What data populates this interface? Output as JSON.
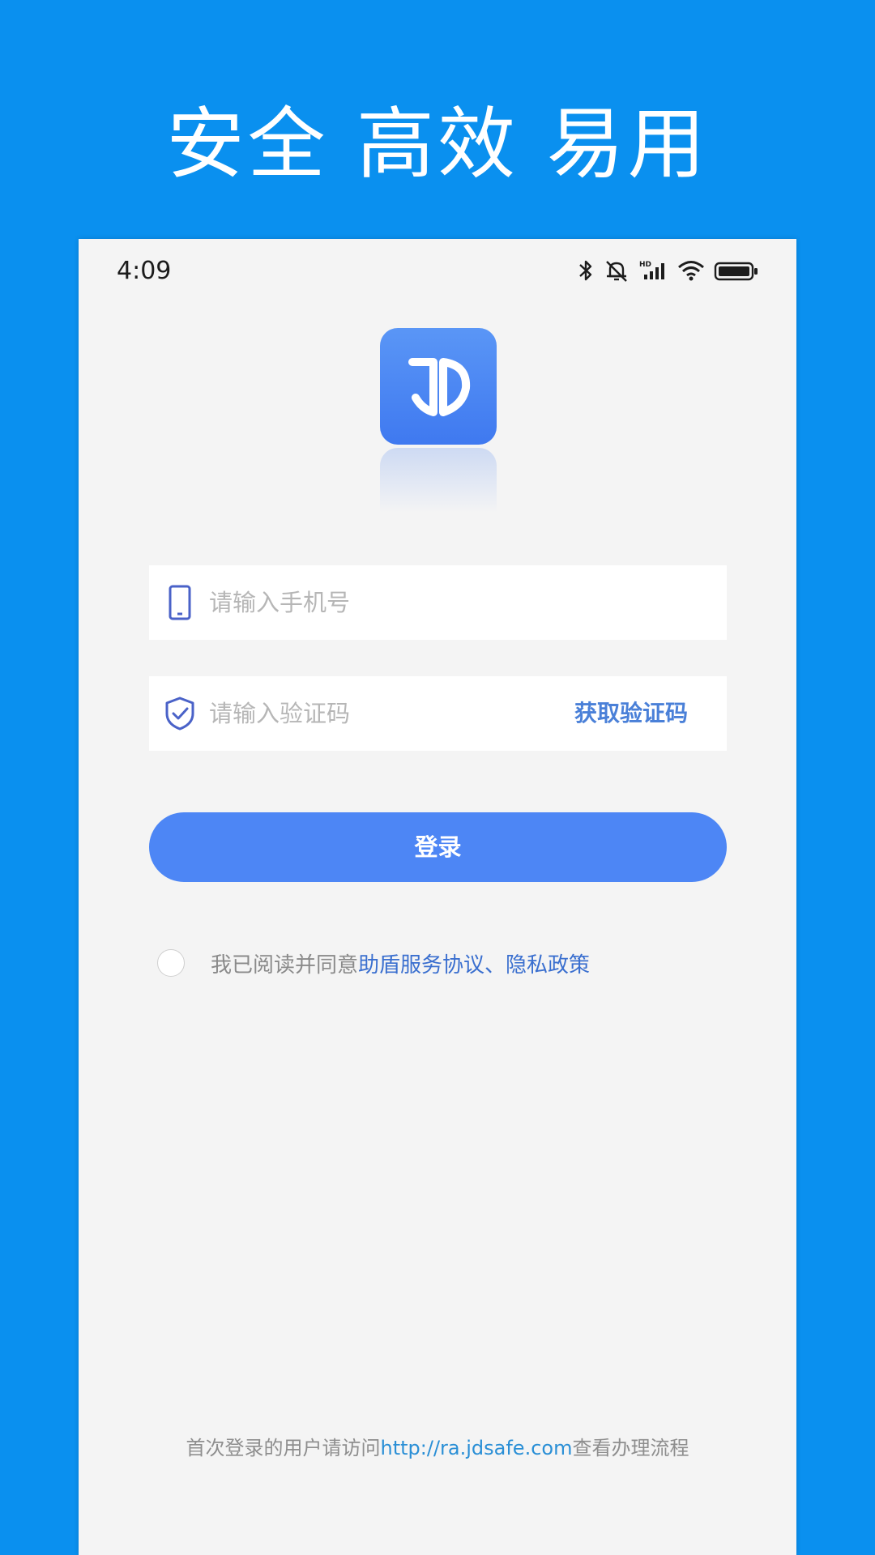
{
  "banner": {
    "title": "安全 高效 易用"
  },
  "status_bar": {
    "time": "4:09",
    "icons": [
      "bluetooth-icon",
      "mute-icon",
      "signal-hd-icon",
      "wifi-icon",
      "battery-icon"
    ]
  },
  "logo": {
    "icon": "shield-jd-logo",
    "color": "#4a86f2"
  },
  "form": {
    "phone": {
      "placeholder": "请输入手机号",
      "value": "",
      "icon": "phone-icon"
    },
    "code": {
      "placeholder": "请输入验证码",
      "value": "",
      "icon": "shield-check-icon"
    },
    "get_code_label": "获取验证码",
    "login_label": "登录"
  },
  "agreement": {
    "prefix": "我已阅读并同意",
    "service_link": "助盾服务协议",
    "separator": "、",
    "privacy_link": "隐私政策",
    "checked": false
  },
  "footer": {
    "prefix": "首次登录的用户请访问",
    "url": "http://ra.jdsafe.com",
    "suffix": "查看办理流程"
  },
  "colors": {
    "background": "#0a90ef",
    "accent": "#4d86f5",
    "link": "#3a6fcf"
  }
}
